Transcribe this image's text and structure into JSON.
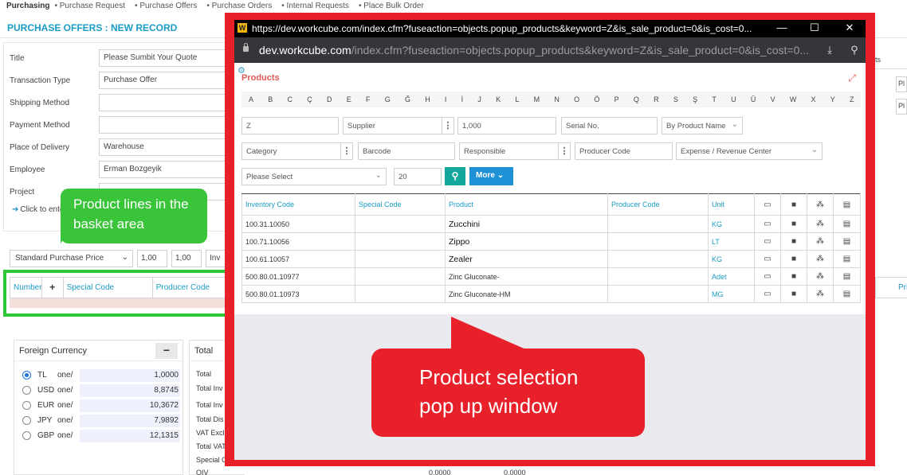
{
  "nav": {
    "items": [
      "Purchasing",
      "Purchase Request",
      "Purchase Offers",
      "Purchase Orders",
      "Internal Requests",
      "Place Bulk Order"
    ]
  },
  "page_title": "PURCHASE OFFERS : NEW RECORD",
  "form": {
    "rows": [
      {
        "label": "Title",
        "value": "Please Sumbit Your Quote"
      },
      {
        "label": "Transaction Type",
        "value": "Purchase Offer"
      },
      {
        "label": "Shipping Method",
        "value": ""
      },
      {
        "label": "Payment Method",
        "value": ""
      },
      {
        "label": "Place of Delivery",
        "value": "Warehouse"
      },
      {
        "label": "Employee",
        "value": "Erman Bozgeyik"
      },
      {
        "label": "Project",
        "value": ""
      }
    ],
    "click_enter": "Click to ente"
  },
  "pricing": {
    "price_list": "Standard Purchase Price",
    "value_1": "1,00",
    "value_2": "1,00",
    "value_3": "Inv"
  },
  "basket": {
    "columns": [
      "Number",
      "+",
      "Special Code",
      "Producer Code"
    ],
    "right_col": "Pri"
  },
  "right_edge": {
    "tab": "ts",
    "box_1": "Pl",
    "box_2": "Pl"
  },
  "green_callout": "Product lines in the basket area",
  "currency": {
    "title": "Foreign Currency",
    "toggle": "−",
    "rows": [
      {
        "code": "TL",
        "one": "one/",
        "value": "1,0000",
        "selected": true
      },
      {
        "code": "USD",
        "one": "one/",
        "value": "8,8745",
        "selected": false
      },
      {
        "code": "EUR",
        "one": "one/",
        "value": "10,3672",
        "selected": false
      },
      {
        "code": "JPY",
        "one": "one/",
        "value": "7,9892",
        "selected": false
      },
      {
        "code": "GBP",
        "one": "one/",
        "value": "12,1315",
        "selected": false
      }
    ]
  },
  "totals": {
    "title": "Total",
    "rows": [
      "Total",
      "Total Inv",
      "Total Inv",
      "Total Dis",
      "VAT Excl",
      "Total VAT",
      "Special C",
      "OIV"
    ],
    "bottom_val_1": "0,0000",
    "bottom_val_2": "0,0000"
  },
  "popup": {
    "titlebar_url": "https://dev.workcube.com/index.cfm?fuseaction=objects.popup_products&keyword=Z&is_sale_product=0&is_cost=0...",
    "address_host": "dev.workcube.com",
    "address_path": "/index.cfm?fuseaction=objects.popup_products&keyword=Z&is_sale_product=0&is_cost=0...",
    "heading": "Products",
    "alphabet": [
      "A",
      "B",
      "C",
      "Ç",
      "D",
      "E",
      "F",
      "G",
      "Ğ",
      "H",
      "I",
      "İ",
      "J",
      "K",
      "L",
      "M",
      "N",
      "O",
      "Ö",
      "P",
      "Q",
      "R",
      "S",
      "Ş",
      "T",
      "U",
      "Ü",
      "V",
      "W",
      "X",
      "Y",
      "Z"
    ],
    "filters": {
      "keyword": "Z",
      "supplier": "Supplier",
      "quantity": "1,000",
      "serial": "Serial No.",
      "sort": "By Product Name",
      "category": "Category",
      "barcode": "Barcode",
      "responsible": "Responsible",
      "producer_code": "Producer Code",
      "center": "Expense / Revenue Center",
      "select": "Please Select",
      "page_size": "20",
      "more": "More"
    },
    "table": {
      "columns": [
        "Inventory Code",
        "Special Code",
        "Product",
        "Producer Code",
        "Unit"
      ],
      "rows": [
        {
          "inventory": "100.31.10050",
          "special": "",
          "product": "Zucchini",
          "producer": "",
          "unit": "KG"
        },
        {
          "inventory": "100.71.10056",
          "special": "",
          "product": "Zippo",
          "producer": "",
          "unit": "LT"
        },
        {
          "inventory": "100.61.10057",
          "special": "",
          "product": "Zealer",
          "producer": "",
          "unit": "KG"
        },
        {
          "inventory": "500.80.01.10977",
          "special": "",
          "product": "Zinc Gluconate-",
          "producer": "",
          "unit": "Adet"
        },
        {
          "inventory": "500.80.01.10973",
          "special": "",
          "product": "Zinc Gluconate-HM",
          "producer": "",
          "unit": "MG"
        }
      ]
    }
  },
  "red_callout": "Product selection pop up window",
  "colors": {
    "accent": "#1a9bc4",
    "popup_frame": "#e8202a",
    "green_callout": "#3ac43a",
    "search_button": "#12a79d",
    "more_button": "#1e90d5"
  }
}
